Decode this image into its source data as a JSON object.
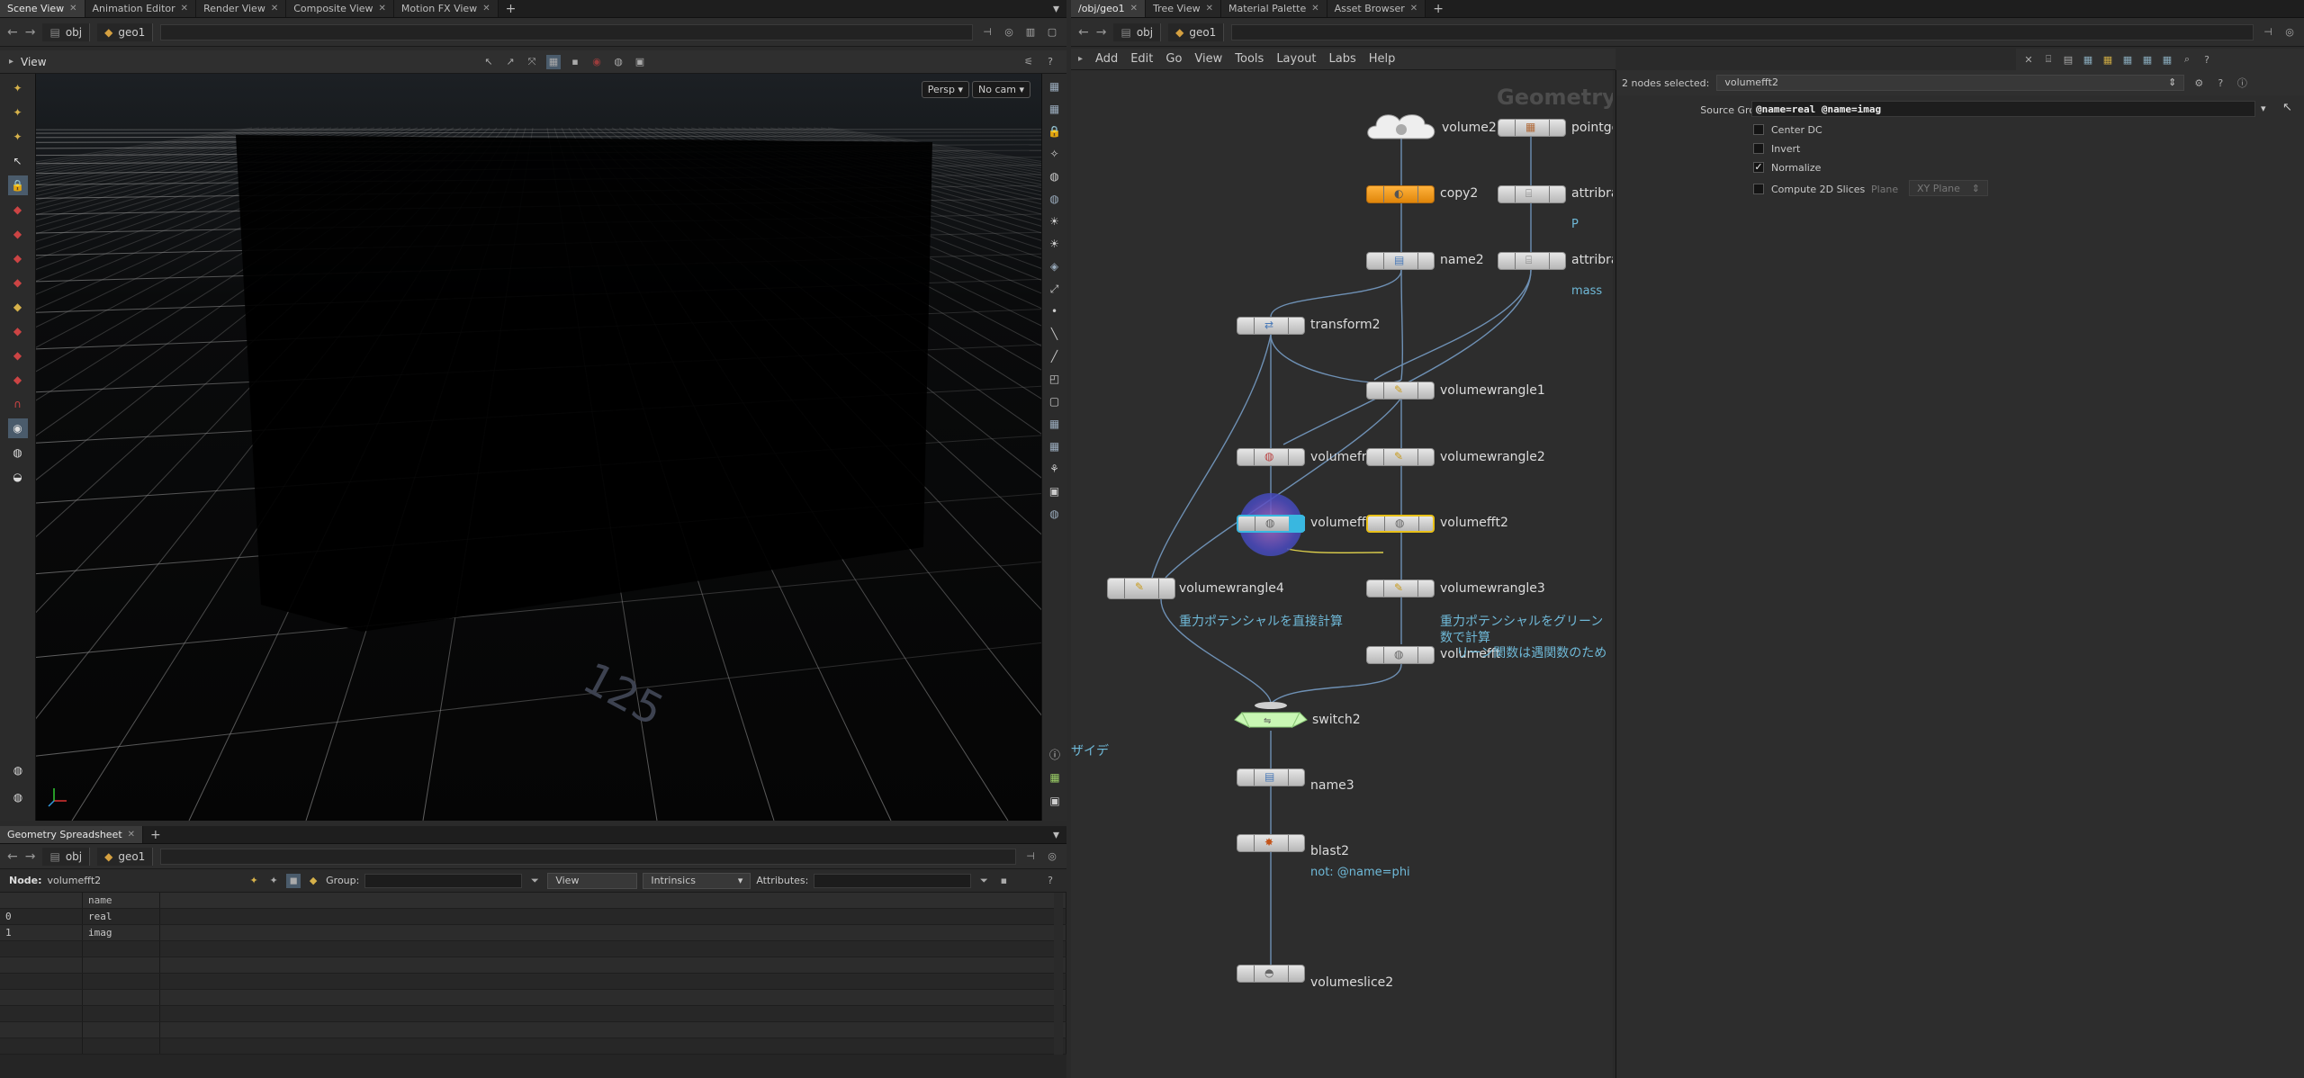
{
  "left_tabs": [
    {
      "label": "Scene View",
      "active": true
    },
    {
      "label": "Animation Editor"
    },
    {
      "label": "Render View"
    },
    {
      "label": "Composite View"
    },
    {
      "label": "Motion FX View"
    }
  ],
  "right_tabs": [
    {
      "label": "/obj/geo1",
      "active": true
    },
    {
      "label": "Tree View"
    },
    {
      "label": "Material Palette"
    },
    {
      "label": "Asset Browser"
    }
  ],
  "left_path": {
    "obj": "obj",
    "geo": "geo1"
  },
  "right_path": {
    "obj": "obj",
    "geo": "geo1"
  },
  "viewport": {
    "title": "View",
    "persp_label": "Persp ▾",
    "cam_label": "No cam ▾",
    "grid_label": "125"
  },
  "spreadsheet": {
    "tab": "Geometry Spreadsheet",
    "path_obj": "obj",
    "path_geo": "geo1",
    "node_label": "Node:",
    "node_value": "volumefft2",
    "group_label": "Group:",
    "view_label": "View",
    "intrinsics_label": "Intrinsics",
    "attributes_label": "Attributes:",
    "column_header": "name",
    "rows": [
      {
        "index": "0",
        "name": "real"
      },
      {
        "index": "1",
        "name": "imag"
      }
    ]
  },
  "network": {
    "menu": [
      "Add",
      "Edit",
      "Go",
      "View",
      "Tools",
      "Layout",
      "Labs",
      "Help"
    ],
    "watermark": "Geometry",
    "nodes": [
      {
        "label": "volume2"
      },
      {
        "label": "pointge"
      },
      {
        "label": "copy2"
      },
      {
        "label": "attribra"
      },
      {
        "label": "name2"
      },
      {
        "label": "attribra"
      },
      {
        "label": "transform2"
      },
      {
        "label": "volumewrangle1"
      },
      {
        "label": "volumefro"
      },
      {
        "label": "volumewrangle2"
      },
      {
        "label": "volumefft"
      },
      {
        "label": "volumefft2"
      },
      {
        "label": "volumewrangle4"
      },
      {
        "label": "volumewrangle3"
      },
      {
        "label": "volumefft"
      },
      {
        "label": "switch2"
      },
      {
        "label": "name3"
      },
      {
        "label": "blast2"
      },
      {
        "label": "volumeslice2"
      }
    ],
    "comments": {
      "attr1": "P",
      "attr2": "mass",
      "vw4": "重力ポテンシャルを直接計算",
      "vw3_a": "重力ポテンシャルをグリーン",
      "vw3_b": "数で計算",
      "vw3_c": "リーン関数は遇関数のため",
      "blast": "not: @name=phi",
      "left_edge": "ザイデ"
    }
  },
  "params": {
    "selected_label": "2 nodes selected:",
    "selected_value": "volumefft2",
    "source_group_label": "Source Group",
    "source_group_value": "@name=real @name=imag",
    "center_dc": "Center DC",
    "invert": "Invert",
    "normalize": "Normalize",
    "normalize_checked": true,
    "compute_2d": "Compute 2D Slices",
    "plane_label": "Plane",
    "plane_value": "XY Plane"
  }
}
